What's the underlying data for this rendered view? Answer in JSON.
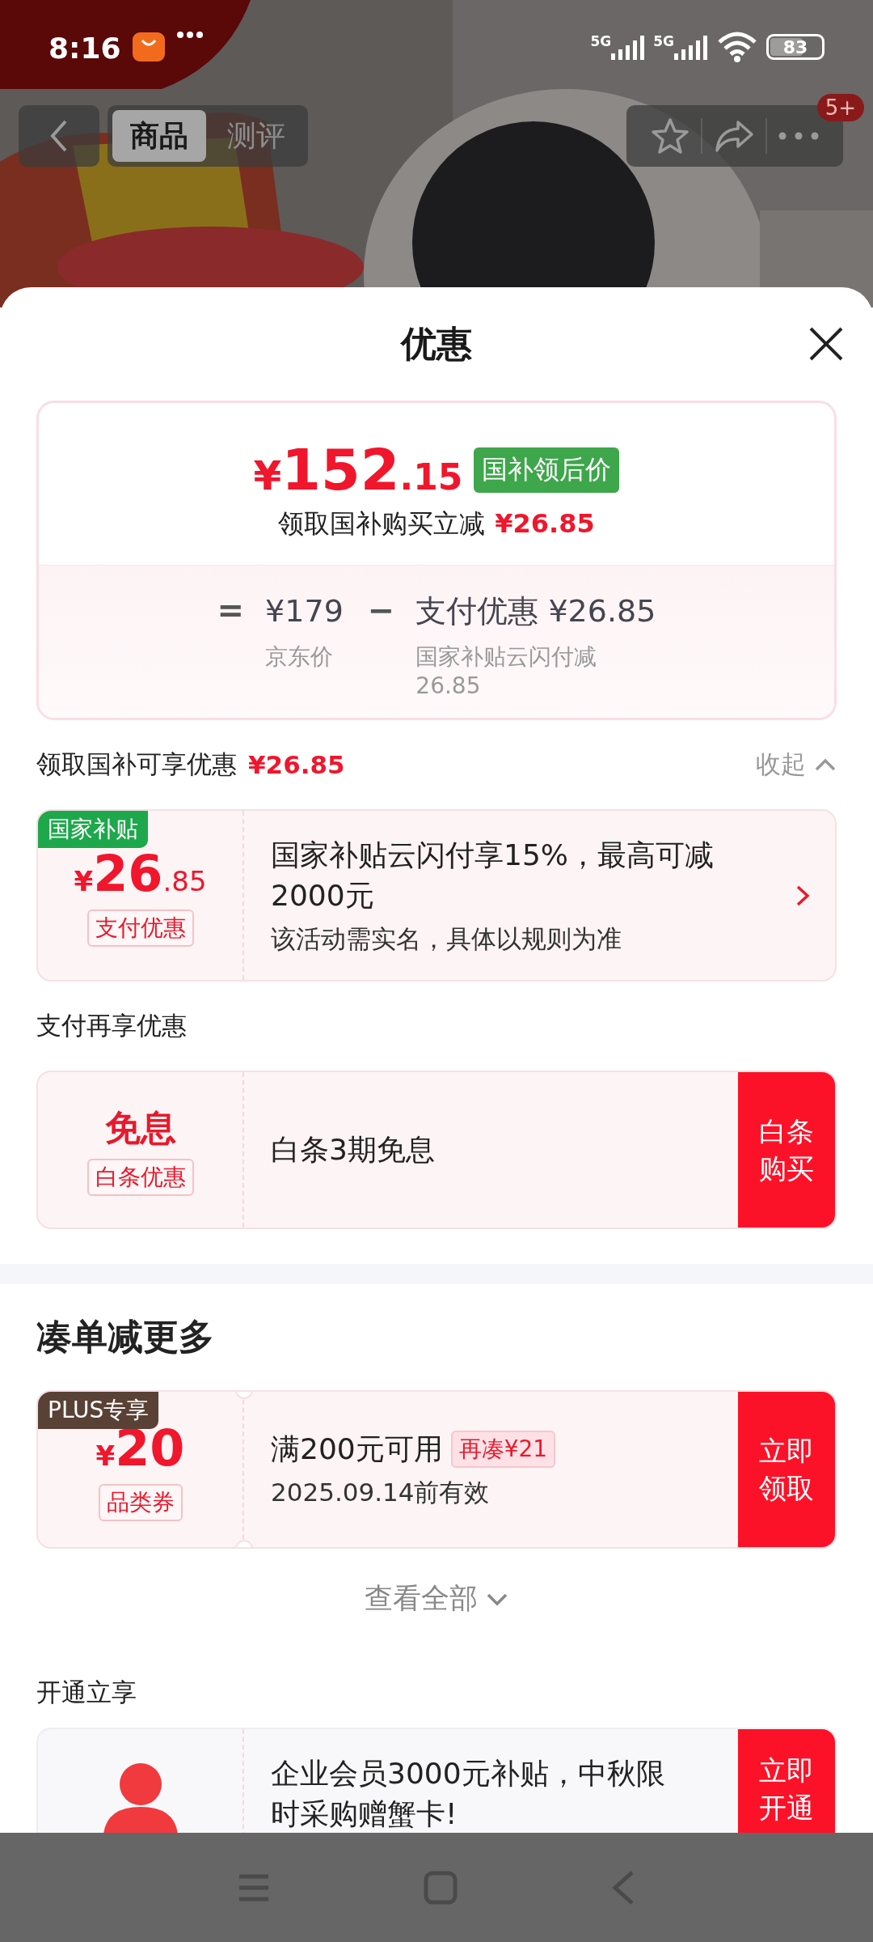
{
  "status_bar": {
    "time": "8:16",
    "networks": [
      "5G",
      "5G"
    ],
    "battery": "83"
  },
  "header": {
    "tabs": [
      {
        "label": "商品",
        "selected": true
      },
      {
        "label": "测评",
        "selected": false
      }
    ],
    "badge": "5+"
  },
  "sheet": {
    "title": "优惠"
  },
  "price_card": {
    "currency": "¥",
    "integer": "152",
    "decimal": ".15",
    "tag": "国补领后价",
    "subtitle": "领取国补购买立减",
    "subtitle_amount": "¥26.85",
    "terms": [
      {
        "op": "=",
        "amount": "¥179",
        "note": "京东价"
      },
      {
        "op": "−",
        "amount": "支付优惠 ¥26.85",
        "note": "国家补贴云闪付减26.85"
      }
    ]
  },
  "sections": [
    {
      "title": "领取国补可享优惠",
      "amount": "¥26.85",
      "toggle": "收起",
      "expanded": true,
      "band": false,
      "cards": [
        {
          "kind": "amount",
          "ribbon": "国家补贴",
          "color": "#1da84b",
          "currency": "¥",
          "integer": "26",
          "decimal": ".85",
          "tag": "支付优惠",
          "text": "国家补贴云闪付享15%，最高可减2000元",
          "note": "该活动需实名，具体以规则为准"
        }
      ]
    },
    {
      "title": "支付再享优惠",
      "band": false,
      "cards": [
        {
          "kind": "label",
          "label": "免息",
          "tag": "白条优惠",
          "text": "白条3期免息",
          "button": "白条购买"
        }
      ]
    },
    {
      "title": "凑单减更多",
      "band": true,
      "more": "查看全部",
      "cards": [
        {
          "kind": "amount",
          "ribbon": "PLUS专享",
          "color": "#5a4136",
          "currency": "¥",
          "integer": "20",
          "tag": "品类券",
          "text": "满200元可用",
          "chip": "再凑¥21",
          "note": "2025.09.14前有效",
          "button": "立即领取"
        }
      ]
    },
    {
      "title": "开通立享",
      "band": false,
      "cards": [
        {
          "kind": "icon",
          "text": "企业会员3000元补贴，中秋限时采购赠蟹卡!",
          "button": "立即开通"
        }
      ]
    }
  ]
}
